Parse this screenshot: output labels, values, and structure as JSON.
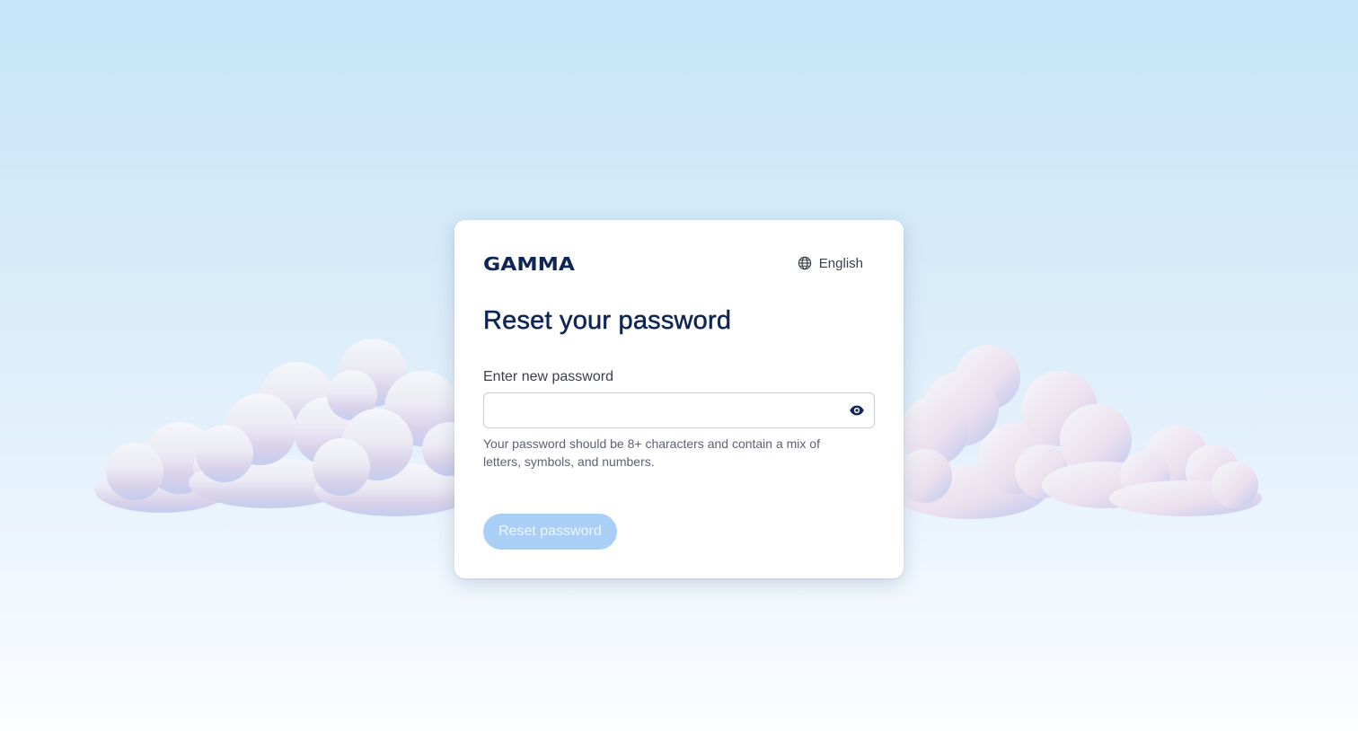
{
  "brand": {
    "logo_text": "GAMMA",
    "color": "#0f2556"
  },
  "language": {
    "label": "English",
    "icon": "globe-icon"
  },
  "form": {
    "title": "Reset your password",
    "password_label": "Enter new password",
    "password_value": "",
    "password_placeholder": "",
    "visibility_icon": "eye-icon",
    "hint": "Your password should be 8+ characters and contain a mix of letters, symbols, and numbers.",
    "submit_label": "Reset password",
    "submit_color": "#a9cff7"
  }
}
